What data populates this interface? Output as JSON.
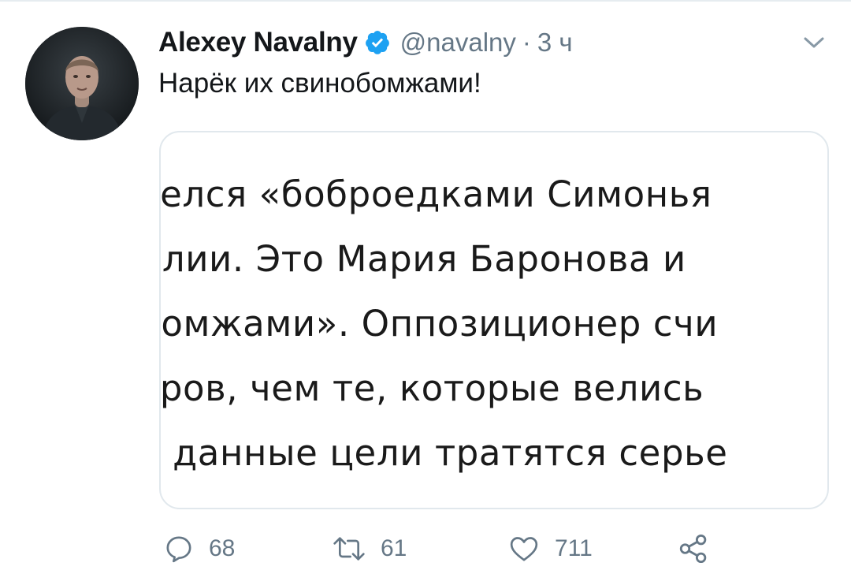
{
  "tweet": {
    "author_name": "Alexey Navalny",
    "handle": "@navalny",
    "separator": "·",
    "time": "3 ч",
    "text": "Нарёк их свинобомжами!",
    "media_lines": [
      "велся «боброедками Симонья",
      "илии. Это Мария Баронова и",
      "бомжами». Оппозиционер счи",
      "тров, чем те, которые велись",
      "а данные цели тратятся серье"
    ],
    "counts": {
      "replies": "68",
      "retweets": "61",
      "likes": "711"
    }
  },
  "icons": {
    "verified": "verified-badge-icon",
    "menu": "chevron-down-icon",
    "reply": "reply-icon",
    "retweet": "retweet-icon",
    "like": "heart-icon",
    "share": "share-icon"
  },
  "colors": {
    "verified_blue": "#1da1f2",
    "secondary_text": "#657786",
    "border": "#e1e8ed"
  }
}
